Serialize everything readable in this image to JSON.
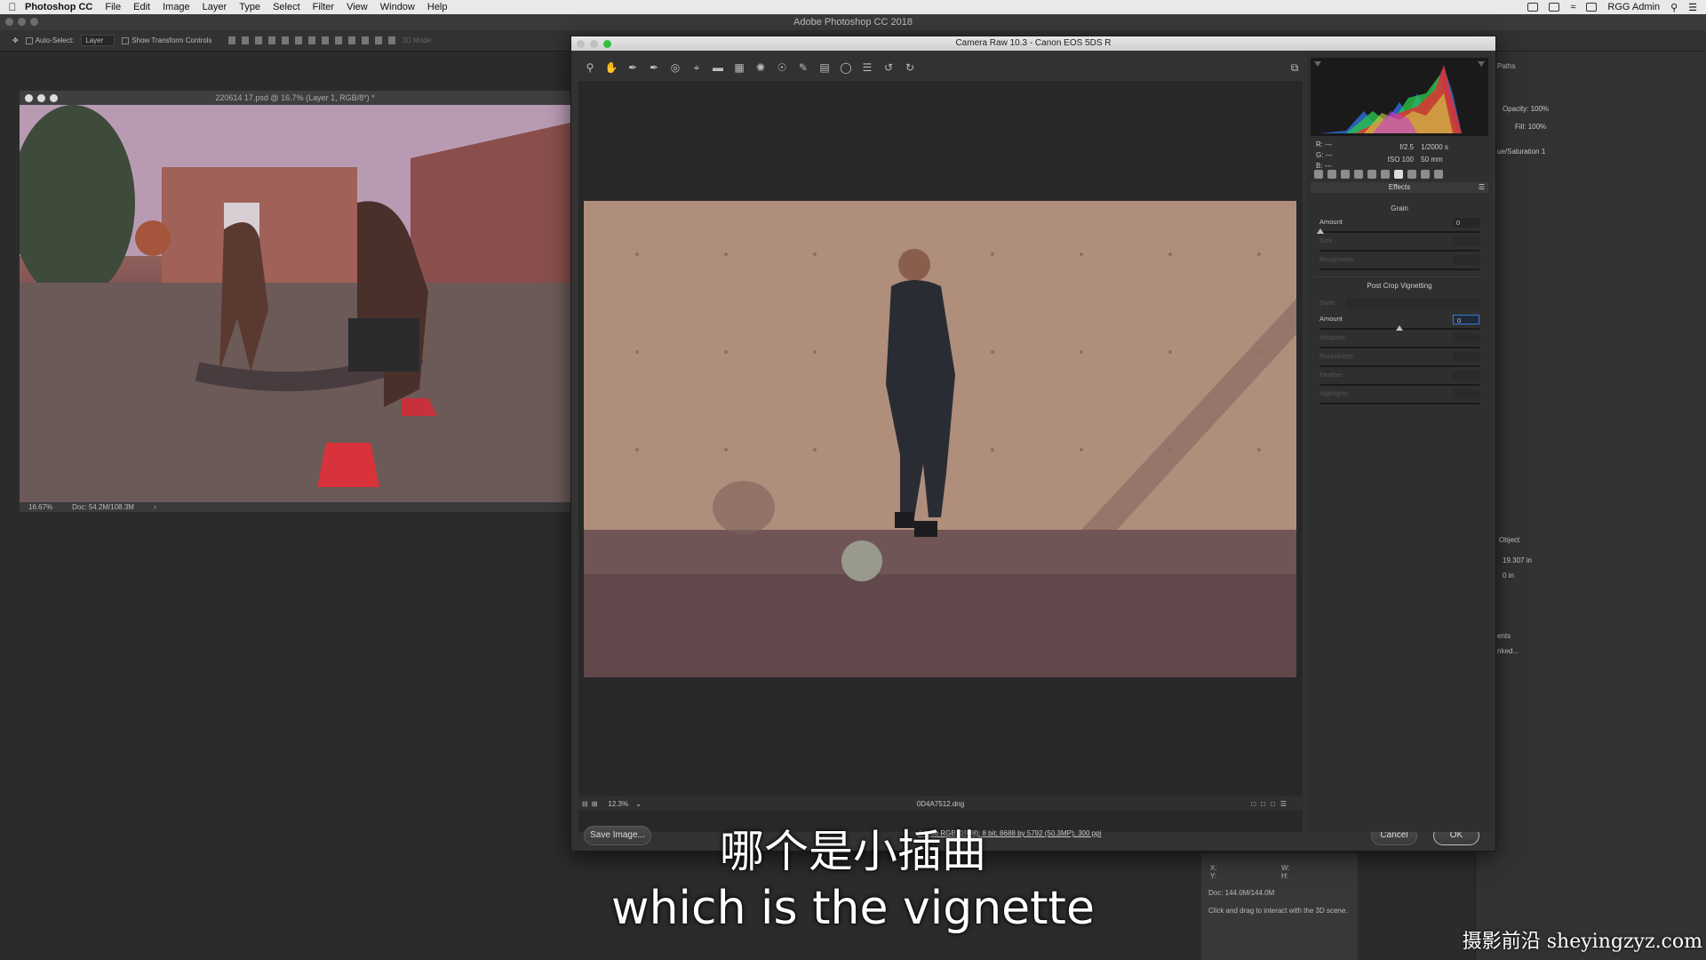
{
  "menubar": {
    "app": "Photoshop CC",
    "items": [
      "File",
      "Edit",
      "Image",
      "Layer",
      "Type",
      "Select",
      "Filter",
      "View",
      "Window",
      "Help"
    ],
    "user": "RGG Admin"
  },
  "app_title": "Adobe Photoshop CC 2018",
  "options": {
    "auto_select": "Auto-Select:",
    "layer": "Layer",
    "show_transform": "Show Transform Controls",
    "mode_3d": "3D Mode:"
  },
  "document": {
    "title": "220614 17.psd @ 16.7% (Layer 1, RGB/8*) *",
    "zoom": "16.67%",
    "doc_size": "Doc: 54.2M/108.3M"
  },
  "right_panels": {
    "paths_tab": "Paths",
    "opacity_label": "Opacity:",
    "opacity": "100%",
    "fill_label": "Fill:",
    "fill": "100%",
    "layer_name": "ue/Saturation 1",
    "object": "Object",
    "width_val": "19.307 in",
    "zero_val": "0 in",
    "ents": "ents",
    "linked": "nked..."
  },
  "info_panel": {
    "xy": "X:\nY:",
    "wh": "W:\nH:",
    "doc": "Doc: 144.0M/144.0M",
    "hint": "Click and drag to interact with the 3D scene."
  },
  "camera_raw": {
    "title": "Camera Raw 10.3  -  Canon EOS 5DS R",
    "zoom": "12.3%",
    "filename": "0D4A7512.dng",
    "workflow": "Adobe RGB (1998); 8 bit; 8688 by 5792 (50.3MP); 300 ppi",
    "save_button": "Save Image...",
    "cancel_button": "Cancel",
    "ok_button": "OK",
    "readout": {
      "r": "R:  ---",
      "g": "G:  ---",
      "b": "B:  ---"
    },
    "exif": {
      "aperture": "f/2.5",
      "shutter": "1/2000 s",
      "iso": "ISO 100",
      "focal": "50 mm"
    },
    "panel_title": "Effects",
    "grain": {
      "title": "Grain",
      "amount_label": "Amount",
      "amount_value": "0",
      "size_label": "Size",
      "roughness_label": "Roughness"
    },
    "vignette": {
      "title": "Post Crop Vignetting",
      "style_label": "Style:",
      "amount_label": "Amount",
      "amount_value": "0",
      "midpoint_label": "Midpoint",
      "roundness_label": "Roundness",
      "feather_label": "Feather",
      "highlights_label": "Highlights"
    }
  },
  "subtitles": {
    "zh": "哪个是小插曲",
    "en": "which is the vignette"
  },
  "watermark": "摄影前沿 sheyingzyz.com"
}
